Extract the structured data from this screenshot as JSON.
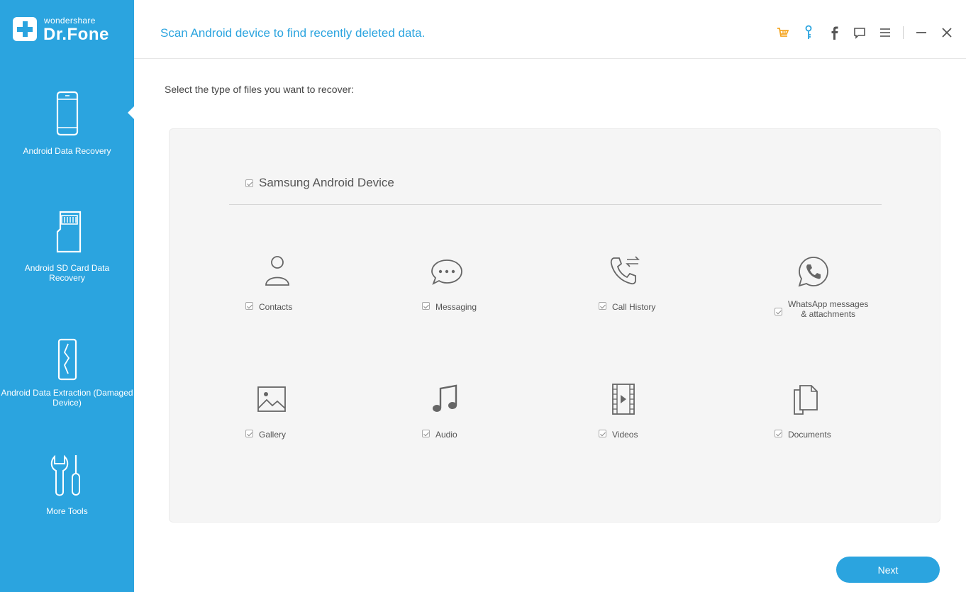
{
  "app": {
    "brand_small": "wondershare",
    "brand_big": "Dr.Fone",
    "accent_color": "#2ba4df"
  },
  "sidebar": {
    "items": [
      {
        "label": "Android Data Recovery",
        "icon": "phone-icon",
        "active": true
      },
      {
        "label": "Android SD Card Data Recovery",
        "icon": "sd-card-icon",
        "active": false
      },
      {
        "label": "Android Data Extraction (Damaged Device)",
        "icon": "broken-phone-icon",
        "active": false
      },
      {
        "label": "More Tools",
        "icon": "tools-icon",
        "active": false
      }
    ]
  },
  "header": {
    "title": "Scan Android device to find recently deleted data.",
    "icons": [
      "cart-icon",
      "key-icon",
      "facebook-icon",
      "feedback-icon",
      "menu-icon",
      "minimize-icon",
      "close-icon"
    ]
  },
  "main": {
    "instruction": "Select the type of files you want to recover:",
    "device": {
      "label": "Samsung Android Device",
      "checked": true
    },
    "file_types": [
      {
        "label": "Contacts",
        "icon": "contacts-icon",
        "checked": true
      },
      {
        "label": "Messaging",
        "icon": "messaging-icon",
        "checked": true
      },
      {
        "label": "Call History",
        "icon": "call-history-icon",
        "checked": true
      },
      {
        "label": "WhatsApp messages\n& attachments",
        "icon": "whatsapp-icon",
        "checked": true
      },
      {
        "label": "Gallery",
        "icon": "gallery-icon",
        "checked": true
      },
      {
        "label": "Audio",
        "icon": "audio-icon",
        "checked": true
      },
      {
        "label": "Videos",
        "icon": "videos-icon",
        "checked": true
      },
      {
        "label": "Documents",
        "icon": "documents-icon",
        "checked": true
      }
    ],
    "next_label": "Next"
  }
}
